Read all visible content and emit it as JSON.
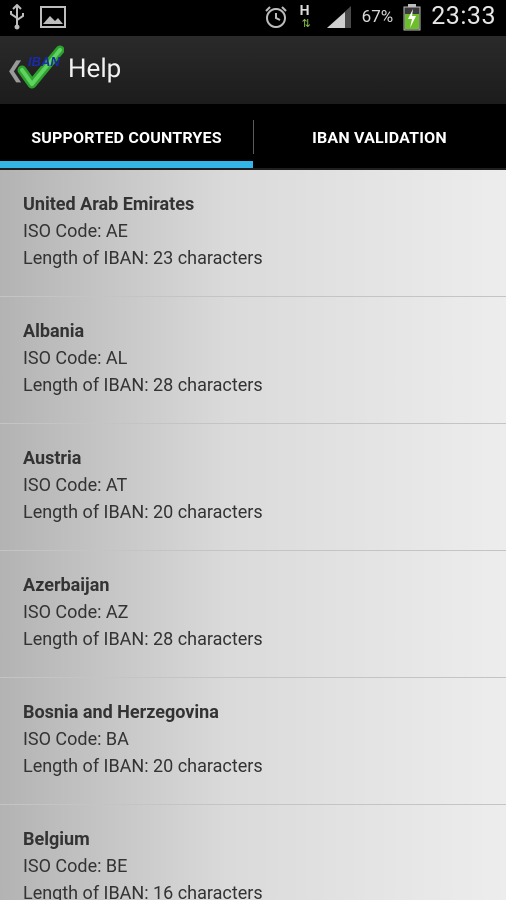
{
  "status_bar": {
    "battery_percent": "67%",
    "time": "23:33",
    "network": "H"
  },
  "action_bar": {
    "logo_text": "IBAN",
    "title": "Help"
  },
  "tabs": [
    {
      "label": "SUPPORTED COUNTRYES",
      "selected": true
    },
    {
      "label": "IBAN VALIDATION",
      "selected": false
    }
  ],
  "countries": [
    {
      "name": "United Arab Emirates",
      "iso": "ISO Code: AE",
      "length": "Length of IBAN: 23 characters"
    },
    {
      "name": "Albania",
      "iso": "ISO Code: AL",
      "length": "Length of IBAN: 28 characters"
    },
    {
      "name": "Austria",
      "iso": "ISO Code: AT",
      "length": "Length of IBAN: 20 characters"
    },
    {
      "name": "Azerbaijan",
      "iso": "ISO Code: AZ",
      "length": "Length of IBAN: 28 characters"
    },
    {
      "name": "Bosnia and Herzegovina",
      "iso": "ISO Code: BA",
      "length": "Length of IBAN: 20 characters"
    },
    {
      "name": "Belgium",
      "iso": "ISO Code: BE",
      "length": "Length of IBAN: 16 characters"
    }
  ],
  "colors": {
    "accent": "#33b5e5",
    "logo_check": "#2fa12f"
  }
}
